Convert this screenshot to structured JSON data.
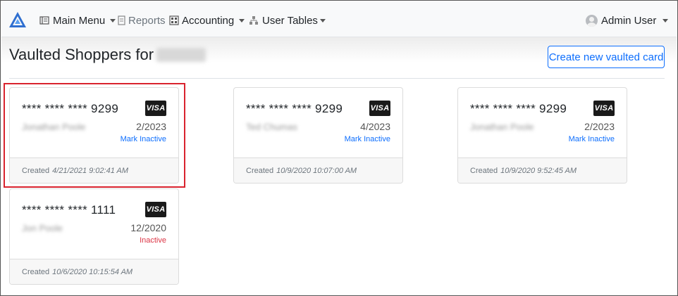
{
  "nav": {
    "main_menu": "Main Menu",
    "reports": "Reports",
    "accounting": "Accounting",
    "user_tables": "User Tables",
    "user": "Admin User"
  },
  "header": {
    "title": "Vaulted Shoppers for",
    "create_button": "Create new vaulted card"
  },
  "cards": [
    {
      "number": "**** **** **** 9299",
      "brand": "VISA",
      "holder": "Jonathan Poole",
      "expiry": "2/2023",
      "status": "Mark Inactive",
      "created_label": "Created",
      "created": "4/21/2021 9:02:41 AM"
    },
    {
      "number": "**** **** **** 9299",
      "brand": "VISA",
      "holder": "Ted Chumas",
      "expiry": "4/2023",
      "status": "Mark Inactive",
      "created_label": "Created",
      "created": "10/9/2020 10:07:00 AM"
    },
    {
      "number": "**** **** **** 9299",
      "brand": "VISA",
      "holder": "Jonathan Poole",
      "expiry": "2/2023",
      "status": "Mark Inactive",
      "created_label": "Created",
      "created": "10/9/2020 9:52:45 AM"
    },
    {
      "number": "**** **** **** 1111",
      "brand": "VISA",
      "holder": "Jon Poole",
      "expiry": "12/2020",
      "status": "Inactive",
      "created_label": "Created",
      "created": "10/6/2020 10:15:54 AM"
    }
  ],
  "colors": {
    "accent": "#0d6efd",
    "danger": "#dc3545",
    "highlight": "#d9232e"
  }
}
